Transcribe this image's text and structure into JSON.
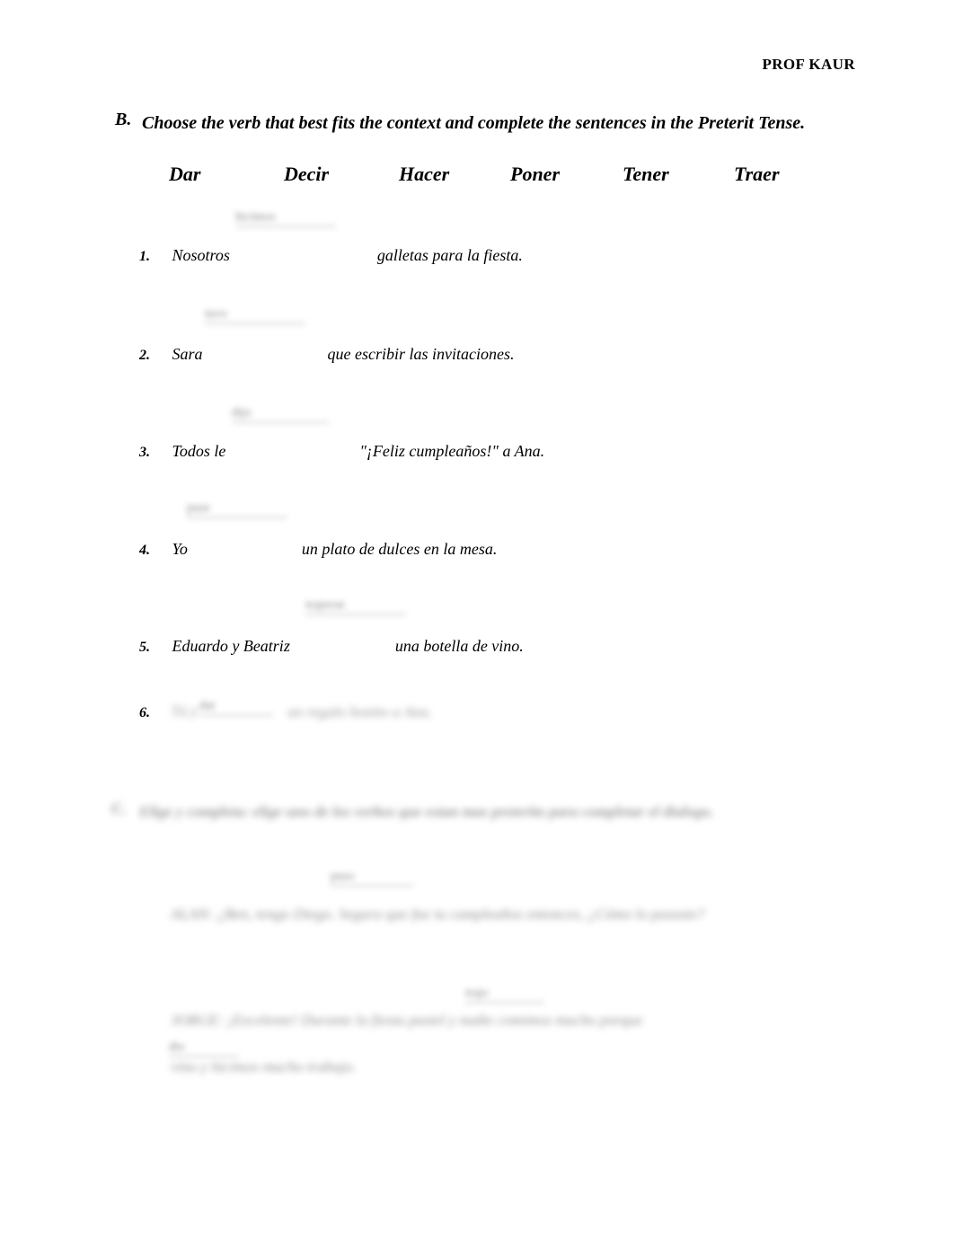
{
  "document": {
    "header": "PROF KAUR",
    "section_b": {
      "label": "B.",
      "title": "Choose the verb that best fits the context and complete the sentences in the Preterit Tense.",
      "verbs": [
        "Dar",
        "Decir",
        "Hacer",
        "Poner",
        "Tener",
        "Traer"
      ],
      "items": [
        {
          "num": "1.",
          "before": "Nosotros",
          "after": "galletas para la fiesta.",
          "answer": "hicimos"
        },
        {
          "num": "2.",
          "before": "Sara",
          "after": "que escribir las invitaciones.",
          "answer": "tuvo"
        },
        {
          "num": "3.",
          "before": "Todos le",
          "after": "\"¡Feliz cumpleaños!\" a Ana.",
          "answer": "dijo"
        },
        {
          "num": "4.",
          "before": "Yo",
          "after": "un plato de dulces en la mesa.",
          "answer": "puse"
        },
        {
          "num": "5.",
          "before": "Eduardo y Beatriz",
          "after": "una botella de vino.",
          "answer": "trajeron"
        },
        {
          "num": "6.",
          "before": "Tú y",
          "after": "un regalo bonito a Ana.",
          "answer": "dar"
        }
      ]
    },
    "section_c": {
      "label": "C.",
      "title": "Elige y completa: elige uno de los verbos que estan mas preterito para completar el dialogo.",
      "lines": [
        "ALAN: ¿Ben, tengo                    Diego. Segura que fue tu cumpleaños entonces, ¿Cómo lo pasaste?",
        "JORGE: ¡Excelente! Durante la fiesta                  pastel y nadie comimos mucho porque",
        "                  vino y hicimos mucho trabajo."
      ]
    }
  }
}
